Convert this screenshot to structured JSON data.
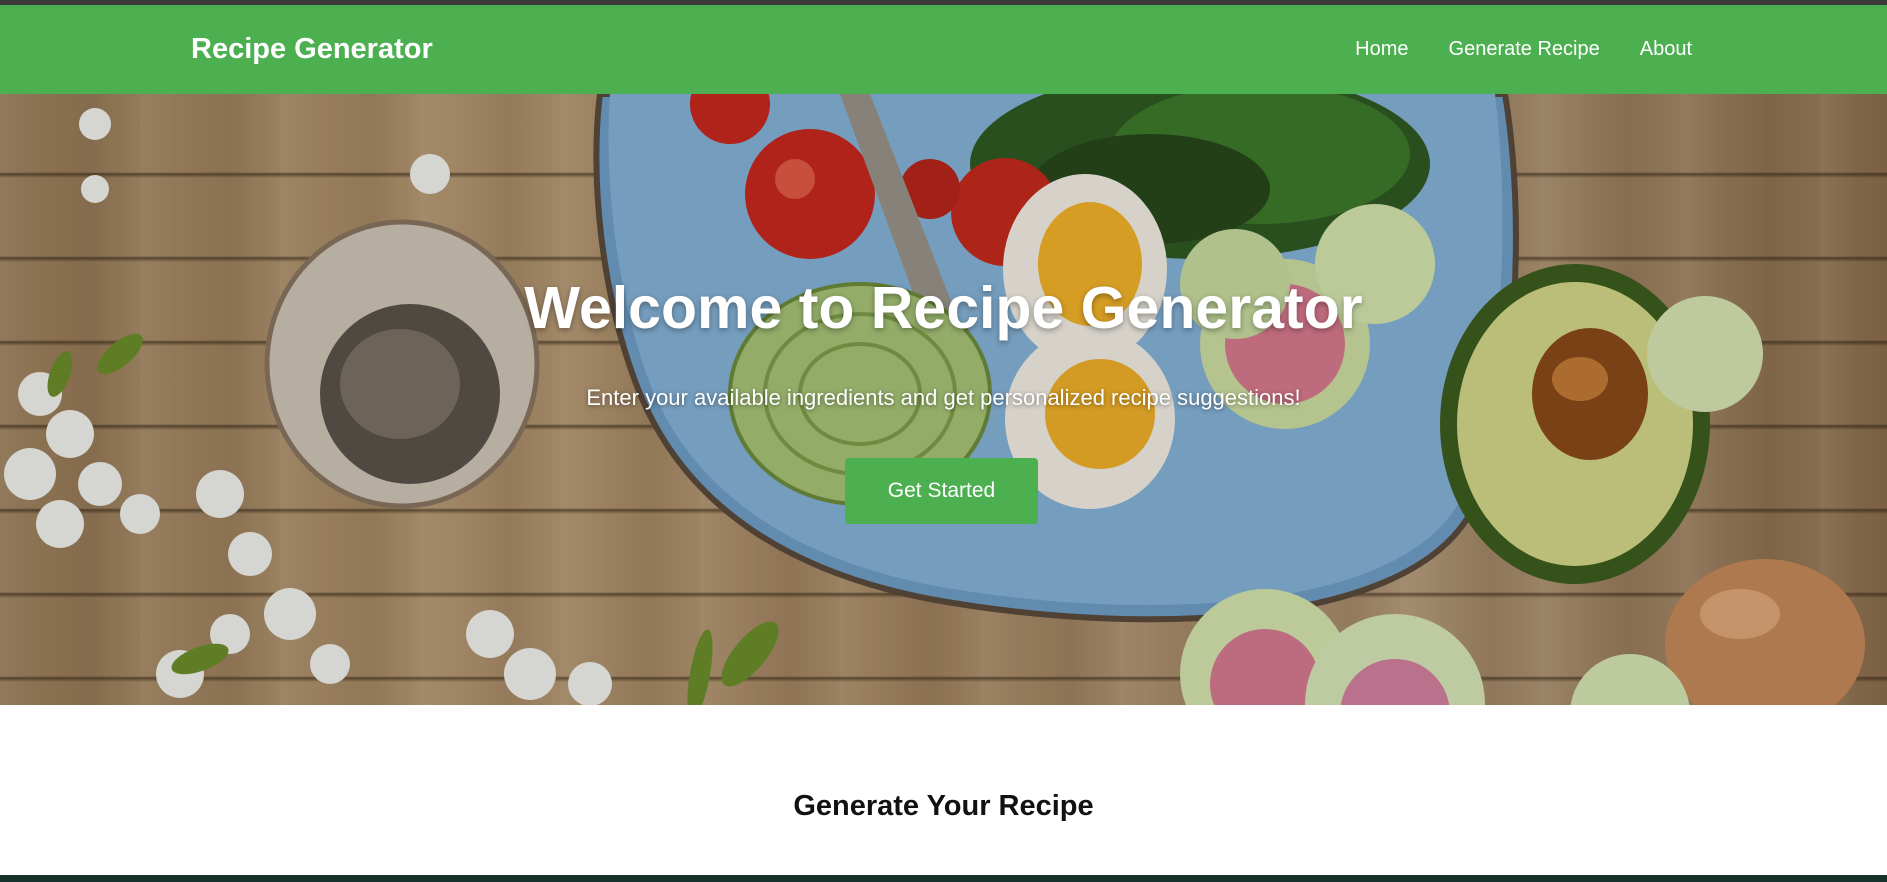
{
  "nav": {
    "brand": "Recipe Generator",
    "links": [
      "Home",
      "Generate Recipe",
      "About"
    ]
  },
  "hero": {
    "title": "Welcome to Recipe Generator",
    "subtitle": "Enter your available ingredients and get personalized recipe suggestions!",
    "cta_label": "Get Started",
    "background": "food-photo"
  },
  "section": {
    "title": "Generate Your Recipe"
  },
  "colors": {
    "primary": "#4caf50",
    "text_light": "#ffffff",
    "text_dark": "#111111"
  }
}
